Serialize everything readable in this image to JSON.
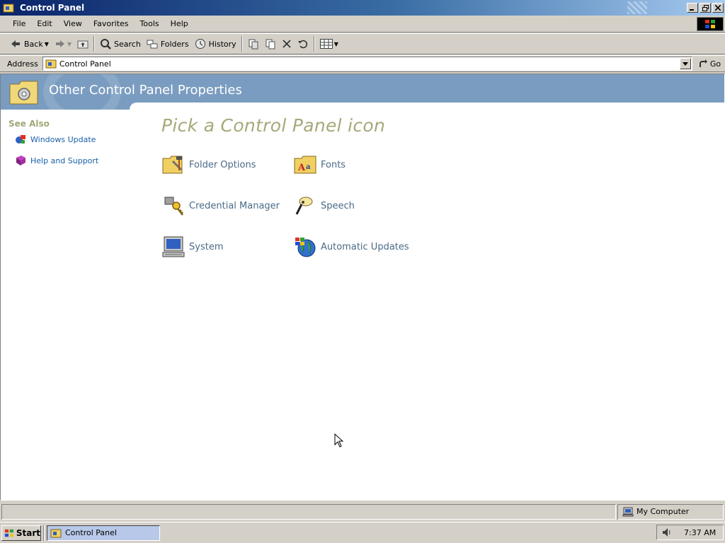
{
  "window": {
    "title": "Control Panel",
    "controls": [
      "minimize",
      "restore",
      "close"
    ]
  },
  "menu": [
    "File",
    "Edit",
    "View",
    "Favorites",
    "Tools",
    "Help"
  ],
  "toolbar": {
    "back": "Back",
    "search": "Search",
    "folders": "Folders",
    "history": "History"
  },
  "address": {
    "label": "Address",
    "value": "Control Panel",
    "go": "Go"
  },
  "banner": {
    "title": "Other Control Panel Properties"
  },
  "see_also": {
    "heading": "See Also",
    "items": [
      {
        "label": "Windows Update",
        "icon": "windows-update-icon"
      },
      {
        "label": "Help and Support",
        "icon": "help-book-icon"
      }
    ]
  },
  "main": {
    "title": "Pick a Control Panel icon",
    "items": [
      {
        "label": "Folder Options",
        "icon": "folder-options-icon"
      },
      {
        "label": "Fonts",
        "icon": "fonts-folder-icon"
      },
      {
        "label": "Credential Manager",
        "icon": "key-icon"
      },
      {
        "label": "Speech",
        "icon": "microphone-icon"
      },
      {
        "label": "System",
        "icon": "computer-icon"
      },
      {
        "label": "Automatic Updates",
        "icon": "globe-update-icon"
      }
    ]
  },
  "status": {
    "zone": "My Computer"
  },
  "taskbar": {
    "start": "Start",
    "task": "Control Panel",
    "clock": "7:37 AM"
  },
  "colors": {
    "banner": "#7a9cc0",
    "link": "#1a5fa8",
    "heading": "#a8a87a",
    "item_text": "#4a6a86"
  }
}
